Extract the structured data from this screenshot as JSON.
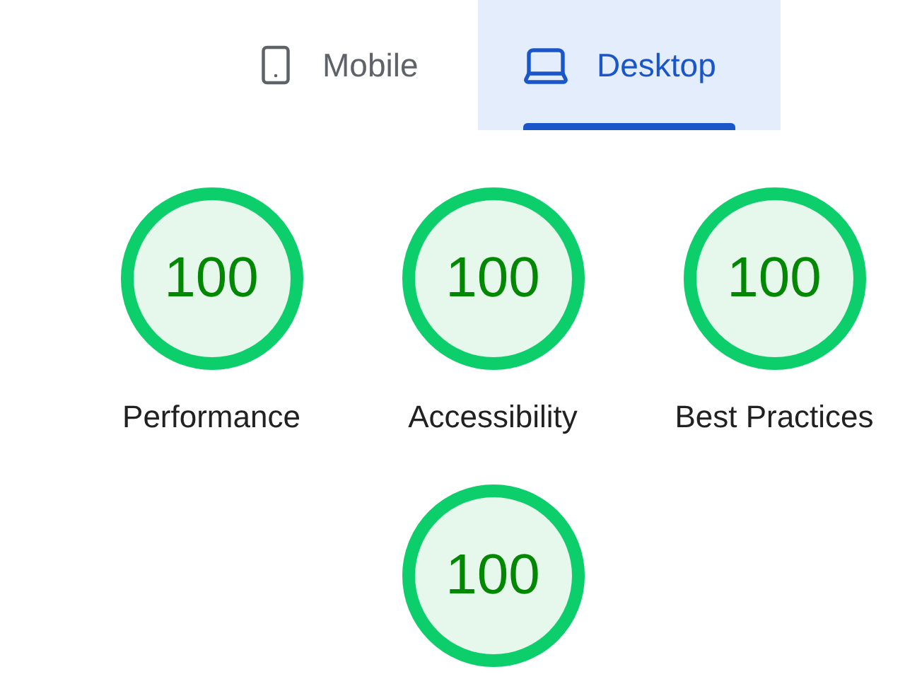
{
  "tabs": [
    {
      "label": "Mobile",
      "kind": "mobile",
      "selected": false
    },
    {
      "label": "Desktop",
      "kind": "desktop",
      "selected": true
    }
  ],
  "gauges": [
    {
      "score": "100",
      "label": "Performance"
    },
    {
      "score": "100",
      "label": "Accessibility"
    },
    {
      "score": "100",
      "label": "Best Practices"
    },
    {
      "score": "100"
    }
  ]
}
